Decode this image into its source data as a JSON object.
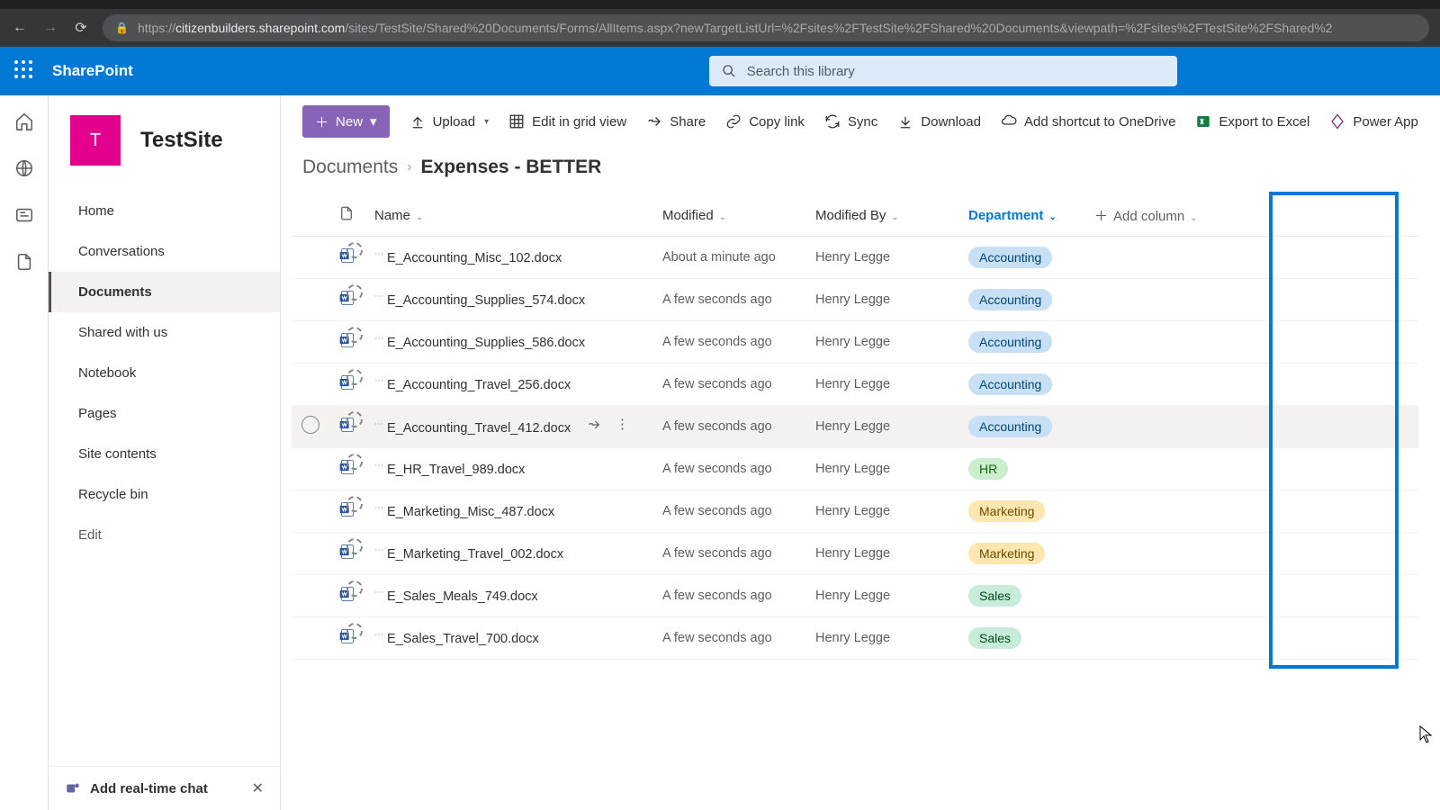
{
  "browser": {
    "url_prefix": "https://",
    "url_domain": "citizenbuilders.sharepoint.com",
    "url_path": "/sites/TestSite/Shared%20Documents/Forms/AllItems.aspx?newTargetListUrl=%2Fsites%2FTestSite%2FShared%20Documents&viewpath=%2Fsites%2FTestSite%2FShared%2"
  },
  "header": {
    "brand": "SharePoint",
    "search_placeholder": "Search this library"
  },
  "site": {
    "initial": "T",
    "title": "TestSite"
  },
  "sidebar": {
    "items": [
      {
        "label": "Home"
      },
      {
        "label": "Conversations"
      },
      {
        "label": "Documents"
      },
      {
        "label": "Shared with us"
      },
      {
        "label": "Notebook"
      },
      {
        "label": "Pages"
      },
      {
        "label": "Site contents"
      },
      {
        "label": "Recycle bin"
      }
    ],
    "edit": "Edit",
    "promo": "Add real-time chat"
  },
  "commands": {
    "new": "New",
    "upload": "Upload",
    "edit_grid": "Edit in grid view",
    "share": "Share",
    "copy_link": "Copy link",
    "sync": "Sync",
    "download": "Download",
    "shortcut": "Add shortcut to OneDrive",
    "export": "Export to Excel",
    "power": "Power App"
  },
  "breadcrumb": {
    "root": "Documents",
    "leaf": "Expenses - BETTER"
  },
  "columns": {
    "name": "Name",
    "modified": "Modified",
    "modified_by": "Modified By",
    "department": "Department",
    "add": "Add column"
  },
  "rows": [
    {
      "name": "E_Accounting_Misc_102.docx",
      "modified": "About a minute ago",
      "by": "Henry Legge",
      "dept": "Accounting",
      "dept_class": "acct"
    },
    {
      "name": "E_Accounting_Supplies_574.docx",
      "modified": "A few seconds ago",
      "by": "Henry Legge",
      "dept": "Accounting",
      "dept_class": "acct"
    },
    {
      "name": "E_Accounting_Supplies_586.docx",
      "modified": "A few seconds ago",
      "by": "Henry Legge",
      "dept": "Accounting",
      "dept_class": "acct"
    },
    {
      "name": "E_Accounting_Travel_256.docx",
      "modified": "A few seconds ago",
      "by": "Henry Legge",
      "dept": "Accounting",
      "dept_class": "acct"
    },
    {
      "name": "E_Accounting_Travel_412.docx",
      "modified": "A few seconds ago",
      "by": "Henry Legge",
      "dept": "Accounting",
      "dept_class": "acct",
      "hover": true
    },
    {
      "name": "E_HR_Travel_989.docx",
      "modified": "A few seconds ago",
      "by": "Henry Legge",
      "dept": "HR",
      "dept_class": "hr"
    },
    {
      "name": "E_Marketing_Misc_487.docx",
      "modified": "A few seconds ago",
      "by": "Henry Legge",
      "dept": "Marketing",
      "dept_class": "mkt"
    },
    {
      "name": "E_Marketing_Travel_002.docx",
      "modified": "A few seconds ago",
      "by": "Henry Legge",
      "dept": "Marketing",
      "dept_class": "mkt"
    },
    {
      "name": "E_Sales_Meals_749.docx",
      "modified": "A few seconds ago",
      "by": "Henry Legge",
      "dept": "Sales",
      "dept_class": "sales"
    },
    {
      "name": "E_Sales_Travel_700.docx",
      "modified": "A few seconds ago",
      "by": "Henry Legge",
      "dept": "Sales",
      "dept_class": "sales"
    }
  ]
}
